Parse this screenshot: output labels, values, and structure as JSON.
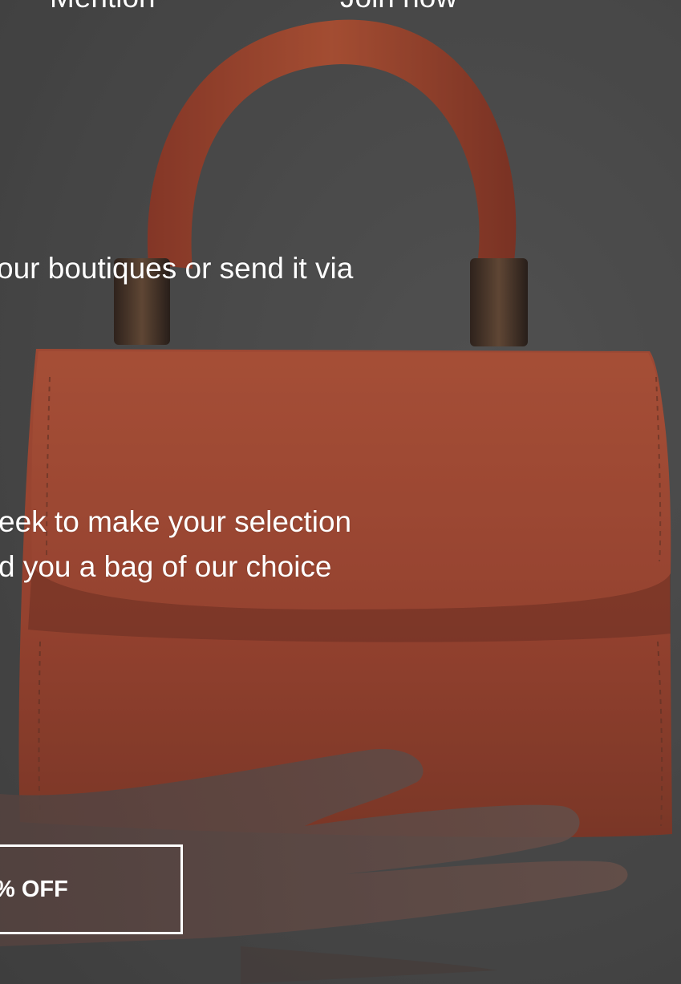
{
  "header": {
    "left_link": "Mention",
    "right_link": "Join now"
  },
  "body": {
    "line_1": "our boutiques or send it via",
    "line_2": "eek to make your selection",
    "line_3": "d you a bag of our choice"
  },
  "cta": {
    "label": "% OFF"
  },
  "colors": {
    "background": "#4a4a4a",
    "bag": "#c24a30",
    "text": "#ffffff"
  },
  "image": {
    "subject": "orange-leather-handbag-on-hand"
  }
}
